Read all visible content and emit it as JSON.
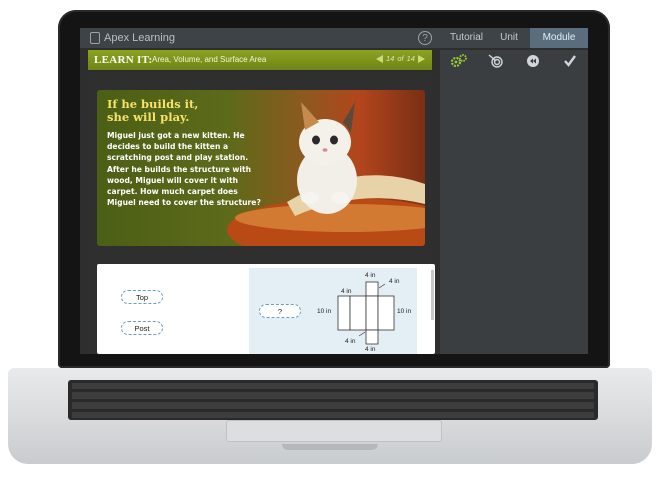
{
  "app": {
    "brand": "Apex Learning",
    "help_glyph": "?"
  },
  "tabs": [
    {
      "label": "Tutorial"
    },
    {
      "label": "Unit"
    },
    {
      "label": "Module",
      "active": true
    }
  ],
  "lesson_bar": {
    "heading": "LEARN IT:",
    "title": "Area, Volume, and Surface Area",
    "page_current": "14",
    "page_of": "of",
    "page_total": "14"
  },
  "tools": [
    {
      "icon": "gears-icon",
      "color": "#9ccc33"
    },
    {
      "icon": "target-icon",
      "color": "#d0d6da"
    },
    {
      "icon": "rewind-icon",
      "color": "#d0d6da"
    },
    {
      "icon": "check-icon",
      "color": "#d0d6da"
    }
  ],
  "hero": {
    "title_line1": "If he builds it,",
    "title_line2": "she will play.",
    "body": "Miguel just got a new kitten. He decides to build the kitten a scratching post and play station. After he builds the structure with wood, Miguel will cover it with carpet. How much carpet does Miguel need to cover the structure?"
  },
  "worksheet": {
    "labels": [
      "Top",
      "Post",
      "?"
    ],
    "dimensions": [
      "4 in",
      "4 in",
      "4 in",
      "10 in",
      "10 in",
      "4 in",
      "4 in"
    ]
  },
  "colors": {
    "accent_green": "#7f961c",
    "active_tab": "#5a6d7d",
    "hero_title": "#f6e26a"
  }
}
